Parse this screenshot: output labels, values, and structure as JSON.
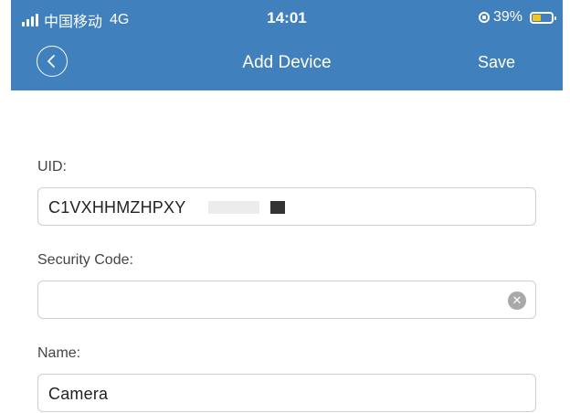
{
  "status_bar": {
    "carrier": "中国移动",
    "network": "4G",
    "time": "14:01",
    "battery_percent": "39%",
    "battery_level": 0.39
  },
  "nav": {
    "title": "Add Device",
    "save_label": "Save",
    "back_icon": "chevron-left-icon"
  },
  "form": {
    "uid": {
      "label": "UID:",
      "value": "C1VXHHMZHPXY"
    },
    "security_code": {
      "label": "Security Code:",
      "value": "",
      "clear_icon": "clear-icon"
    },
    "name": {
      "label": "Name:",
      "value": "Camera"
    }
  },
  "colors": {
    "header_bg": "#3f80bd",
    "battery_fill": "#f5c518"
  }
}
